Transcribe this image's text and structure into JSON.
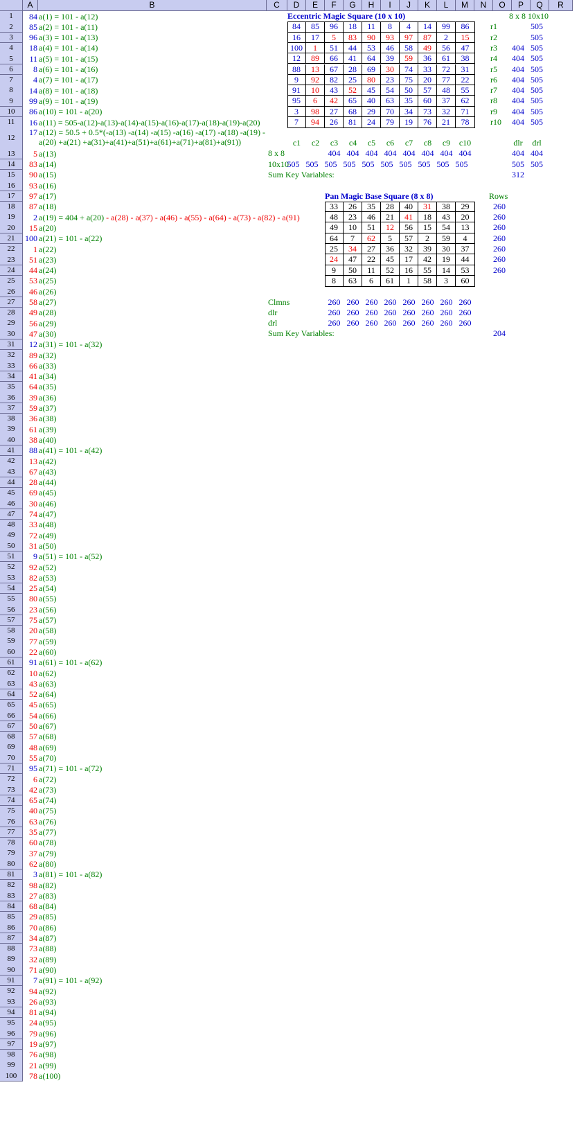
{
  "columns": [
    "A",
    "B",
    "C",
    "D",
    "E",
    "F",
    "G",
    "H",
    "I",
    "J",
    "K",
    "L",
    "M",
    "N",
    "O",
    "P",
    "Q",
    "R"
  ],
  "colors": {
    "blue": "#0000cc",
    "red": "#ee0000",
    "green": "#008000",
    "header_bg": "#c8ccf0"
  },
  "column_a": [
    {
      "v": "84",
      "c": "blue",
      "b": "a(1) = 101 - a(12)"
    },
    {
      "v": "85",
      "c": "blue",
      "b": "a(2) = 101 - a(11)"
    },
    {
      "v": "96",
      "c": "blue",
      "b": "a(3) = 101 - a(13)"
    },
    {
      "v": "18",
      "c": "blue",
      "b": "a(4) = 101 - a(14)"
    },
    {
      "v": "11",
      "c": "blue",
      "b": "a(5) = 101 - a(15)"
    },
    {
      "v": "8",
      "c": "blue",
      "b": "a(6) = 101 - a(16)"
    },
    {
      "v": "4",
      "c": "blue",
      "b": "a(7) = 101 - a(17)"
    },
    {
      "v": "14",
      "c": "blue",
      "b": "a(8) = 101 - a(18)"
    },
    {
      "v": "99",
      "c": "blue",
      "b": "a(9) = 101 - a(19)"
    },
    {
      "v": "86",
      "c": "blue",
      "b": "a(10) = 101 - a(20)"
    },
    {
      "v": "16",
      "c": "blue",
      "b": "a(11) = 505-a(12)-a(13)-a(14)-a(15)-a(16)-a(17)-a(18)-a(19)-a(20)"
    },
    {
      "v": "17",
      "c": "blue",
      "b": "a(12) = 50.5 + 0.5*(-a(13) -a(14) -a(15) -a(16) -a(17) -a(18) -a(19) -",
      "b2": "a(20) +a(21) +a(31)+a(41)+a(51)+a(61)+a(71)+a(81)+a(91))"
    },
    {
      "v": "5",
      "c": "red",
      "b": "a(13)"
    },
    {
      "v": "83",
      "c": "red",
      "b": "a(14)"
    },
    {
      "v": "90",
      "c": "red",
      "b": "a(15)"
    },
    {
      "v": "93",
      "c": "red",
      "b": "a(16)"
    },
    {
      "v": "97",
      "c": "red",
      "b": "a(17)"
    },
    {
      "v": "87",
      "c": "red",
      "b": "a(18)"
    },
    {
      "v": "2",
      "c": "blue",
      "b": "a(19) = 404 + a(20) - a(28) - a(37) - a(46) - a(55) - a(64) - a(73) - a(82) - a(91)",
      "mixed": true
    },
    {
      "v": "15",
      "c": "red",
      "b": "a(20)"
    },
    {
      "v": "100",
      "c": "blue",
      "b": "a(21) = 101 - a(22)"
    },
    {
      "v": "1",
      "c": "red",
      "b": "a(22)"
    },
    {
      "v": "51",
      "c": "red",
      "b": "a(23)"
    },
    {
      "v": "44",
      "c": "red",
      "b": "a(24)"
    },
    {
      "v": "53",
      "c": "red",
      "b": "a(25)"
    },
    {
      "v": "46",
      "c": "red",
      "b": "a(26)"
    },
    {
      "v": "58",
      "c": "red",
      "b": "a(27)"
    },
    {
      "v": "49",
      "c": "red",
      "b": "a(28)"
    },
    {
      "v": "56",
      "c": "red",
      "b": "a(29)"
    },
    {
      "v": "47",
      "c": "red",
      "b": "a(30)"
    },
    {
      "v": "12",
      "c": "blue",
      "b": "a(31) = 101 - a(32)"
    },
    {
      "v": "89",
      "c": "red",
      "b": "a(32)"
    },
    {
      "v": "66",
      "c": "red",
      "b": "a(33)"
    },
    {
      "v": "41",
      "c": "red",
      "b": "a(34)"
    },
    {
      "v": "64",
      "c": "red",
      "b": "a(35)"
    },
    {
      "v": "39",
      "c": "red",
      "b": "a(36)"
    },
    {
      "v": "59",
      "c": "red",
      "b": "a(37)"
    },
    {
      "v": "36",
      "c": "red",
      "b": "a(38)"
    },
    {
      "v": "61",
      "c": "red",
      "b": "a(39)"
    },
    {
      "v": "38",
      "c": "red",
      "b": "a(40)"
    },
    {
      "v": "88",
      "c": "blue",
      "b": "a(41) = 101 - a(42)"
    },
    {
      "v": "13",
      "c": "red",
      "b": "a(42)"
    },
    {
      "v": "67",
      "c": "red",
      "b": "a(43)"
    },
    {
      "v": "28",
      "c": "red",
      "b": "a(44)"
    },
    {
      "v": "69",
      "c": "red",
      "b": "a(45)"
    },
    {
      "v": "30",
      "c": "red",
      "b": "a(46)"
    },
    {
      "v": "74",
      "c": "red",
      "b": "a(47)"
    },
    {
      "v": "33",
      "c": "red",
      "b": "a(48)"
    },
    {
      "v": "72",
      "c": "red",
      "b": "a(49)"
    },
    {
      "v": "31",
      "c": "red",
      "b": "a(50)"
    },
    {
      "v": "9",
      "c": "blue",
      "b": "a(51) = 101 - a(52)"
    },
    {
      "v": "92",
      "c": "red",
      "b": "a(52)"
    },
    {
      "v": "82",
      "c": "red",
      "b": "a(53)"
    },
    {
      "v": "25",
      "c": "red",
      "b": "a(54)"
    },
    {
      "v": "80",
      "c": "red",
      "b": "a(55)"
    },
    {
      "v": "23",
      "c": "red",
      "b": "a(56)"
    },
    {
      "v": "75",
      "c": "red",
      "b": "a(57)"
    },
    {
      "v": "20",
      "c": "red",
      "b": "a(58)"
    },
    {
      "v": "77",
      "c": "red",
      "b": "a(59)"
    },
    {
      "v": "22",
      "c": "red",
      "b": "a(60)"
    },
    {
      "v": "91",
      "c": "blue",
      "b": "a(61) = 101 - a(62)"
    },
    {
      "v": "10",
      "c": "red",
      "b": "a(62)"
    },
    {
      "v": "43",
      "c": "red",
      "b": "a(63)"
    },
    {
      "v": "52",
      "c": "red",
      "b": "a(64)"
    },
    {
      "v": "45",
      "c": "red",
      "b": "a(65)"
    },
    {
      "v": "54",
      "c": "red",
      "b": "a(66)"
    },
    {
      "v": "50",
      "c": "red",
      "b": "a(67)"
    },
    {
      "v": "57",
      "c": "red",
      "b": "a(68)"
    },
    {
      "v": "48",
      "c": "red",
      "b": "a(69)"
    },
    {
      "v": "55",
      "c": "red",
      "b": "a(70)"
    },
    {
      "v": "95",
      "c": "blue",
      "b": "a(71) = 101 - a(72)"
    },
    {
      "v": "6",
      "c": "red",
      "b": "a(72)"
    },
    {
      "v": "42",
      "c": "red",
      "b": "a(73)"
    },
    {
      "v": "65",
      "c": "red",
      "b": "a(74)"
    },
    {
      "v": "40",
      "c": "red",
      "b": "a(75)"
    },
    {
      "v": "63",
      "c": "red",
      "b": "a(76)"
    },
    {
      "v": "35",
      "c": "red",
      "b": "a(77)"
    },
    {
      "v": "60",
      "c": "red",
      "b": "a(78)"
    },
    {
      "v": "37",
      "c": "red",
      "b": "a(79)"
    },
    {
      "v": "62",
      "c": "red",
      "b": "a(80)"
    },
    {
      "v": "3",
      "c": "blue",
      "b": "a(81) = 101 - a(82)"
    },
    {
      "v": "98",
      "c": "red",
      "b": "a(82)"
    },
    {
      "v": "27",
      "c": "red",
      "b": "a(83)"
    },
    {
      "v": "68",
      "c": "red",
      "b": "a(84)"
    },
    {
      "v": "29",
      "c": "red",
      "b": "a(85)"
    },
    {
      "v": "70",
      "c": "red",
      "b": "a(86)"
    },
    {
      "v": "34",
      "c": "red",
      "b": "a(87)"
    },
    {
      "v": "73",
      "c": "red",
      "b": "a(88)"
    },
    {
      "v": "32",
      "c": "red",
      "b": "a(89)"
    },
    {
      "v": "71",
      "c": "red",
      "b": "a(90)"
    },
    {
      "v": "7",
      "c": "blue",
      "b": "a(91) = 101 - a(92)"
    },
    {
      "v": "94",
      "c": "red",
      "b": "a(92)"
    },
    {
      "v": "26",
      "c": "red",
      "b": "a(93)"
    },
    {
      "v": "81",
      "c": "red",
      "b": "a(94)"
    },
    {
      "v": "24",
      "c": "red",
      "b": "a(95)"
    },
    {
      "v": "79",
      "c": "red",
      "b": "a(96)"
    },
    {
      "v": "19",
      "c": "red",
      "b": "a(97)"
    },
    {
      "v": "76",
      "c": "red",
      "b": "a(98)"
    },
    {
      "v": "21",
      "c": "red",
      "b": "a(99)"
    },
    {
      "v": "78",
      "c": "red",
      "b": "a(100)"
    }
  ],
  "row19_parts": [
    {
      "t": "a(19) = 404 + a(20) ",
      "c": "green"
    },
    {
      "t": "- a(28) - a(37) - a(46) - a(55) - a(64) - a(73) - a(82) - a(91)",
      "c": "red"
    }
  ],
  "eccentric": {
    "title": "Eccentric Magic Square (10 x 10)",
    "rows": [
      [
        [
          "84",
          "b"
        ],
        [
          "85",
          "b"
        ],
        [
          "96",
          "b"
        ],
        [
          "18",
          "b"
        ],
        [
          "11",
          "b"
        ],
        [
          "8",
          "b"
        ],
        [
          "4",
          "b"
        ],
        [
          "14",
          "b"
        ],
        [
          "99",
          "b"
        ],
        [
          "86",
          "b"
        ]
      ],
      [
        [
          "16",
          "b"
        ],
        [
          "17",
          "b"
        ],
        [
          "5",
          "r"
        ],
        [
          "83",
          "r"
        ],
        [
          "90",
          "r"
        ],
        [
          "93",
          "r"
        ],
        [
          "97",
          "r"
        ],
        [
          "87",
          "r"
        ],
        [
          "2",
          "b"
        ],
        [
          "15",
          "r"
        ]
      ],
      [
        [
          "100",
          "b"
        ],
        [
          "1",
          "r"
        ],
        [
          "51",
          "b"
        ],
        [
          "44",
          "b"
        ],
        [
          "53",
          "b"
        ],
        [
          "46",
          "b"
        ],
        [
          "58",
          "b"
        ],
        [
          "49",
          "r"
        ],
        [
          "56",
          "b"
        ],
        [
          "47",
          "b"
        ]
      ],
      [
        [
          "12",
          "b"
        ],
        [
          "89",
          "r"
        ],
        [
          "66",
          "b"
        ],
        [
          "41",
          "b"
        ],
        [
          "64",
          "b"
        ],
        [
          "39",
          "b"
        ],
        [
          "59",
          "r"
        ],
        [
          "36",
          "b"
        ],
        [
          "61",
          "b"
        ],
        [
          "38",
          "b"
        ]
      ],
      [
        [
          "88",
          "b"
        ],
        [
          "13",
          "r"
        ],
        [
          "67",
          "b"
        ],
        [
          "28",
          "b"
        ],
        [
          "69",
          "b"
        ],
        [
          "30",
          "r"
        ],
        [
          "74",
          "b"
        ],
        [
          "33",
          "b"
        ],
        [
          "72",
          "b"
        ],
        [
          "31",
          "b"
        ]
      ],
      [
        [
          "9",
          "b"
        ],
        [
          "92",
          "r"
        ],
        [
          "82",
          "b"
        ],
        [
          "25",
          "b"
        ],
        [
          "80",
          "r"
        ],
        [
          "23",
          "b"
        ],
        [
          "75",
          "b"
        ],
        [
          "20",
          "b"
        ],
        [
          "77",
          "b"
        ],
        [
          "22",
          "b"
        ]
      ],
      [
        [
          "91",
          "b"
        ],
        [
          "10",
          "r"
        ],
        [
          "43",
          "b"
        ],
        [
          "52",
          "r"
        ],
        [
          "45",
          "b"
        ],
        [
          "54",
          "b"
        ],
        [
          "50",
          "b"
        ],
        [
          "57",
          "b"
        ],
        [
          "48",
          "b"
        ],
        [
          "55",
          "b"
        ]
      ],
      [
        [
          "95",
          "b"
        ],
        [
          "6",
          "r"
        ],
        [
          "42",
          "r"
        ],
        [
          "65",
          "b"
        ],
        [
          "40",
          "b"
        ],
        [
          "63",
          "b"
        ],
        [
          "35",
          "b"
        ],
        [
          "60",
          "b"
        ],
        [
          "37",
          "b"
        ],
        [
          "62",
          "b"
        ]
      ],
      [
        [
          "3",
          "b"
        ],
        [
          "98",
          "r"
        ],
        [
          "27",
          "b"
        ],
        [
          "68",
          "b"
        ],
        [
          "29",
          "b"
        ],
        [
          "70",
          "b"
        ],
        [
          "34",
          "b"
        ],
        [
          "73",
          "b"
        ],
        [
          "32",
          "b"
        ],
        [
          "71",
          "b"
        ]
      ],
      [
        [
          "7",
          "b"
        ],
        [
          "94",
          "r"
        ],
        [
          "26",
          "b"
        ],
        [
          "81",
          "b"
        ],
        [
          "24",
          "b"
        ],
        [
          "79",
          "b"
        ],
        [
          "19",
          "b"
        ],
        [
          "76",
          "b"
        ],
        [
          "21",
          "b"
        ],
        [
          "78",
          "b"
        ]
      ]
    ],
    "row_labels": [
      "r1",
      "r2",
      "r3",
      "r4",
      "r5",
      "r6",
      "r7",
      "r8",
      "r9",
      "r10"
    ],
    "col8_header": "8 x 8",
    "col10_header": "10x10",
    "col8": [
      "",
      "",
      "404",
      "404",
      "404",
      "404",
      "404",
      "404",
      "404",
      "404"
    ],
    "col10": [
      "505",
      "505",
      "505",
      "505",
      "505",
      "505",
      "505",
      "505",
      "505",
      "505"
    ],
    "col_labels": [
      "c1",
      "c2",
      "c3",
      "c4",
      "c5",
      "c6",
      "c7",
      "c8",
      "c9",
      "c10"
    ],
    "diag_labels": [
      "dlr",
      "drl"
    ],
    "row13_label": "8 x 8",
    "row13_values": [
      "",
      "",
      "404",
      "404",
      "404",
      "404",
      "404",
      "404",
      "404",
      "404"
    ],
    "row13_diag": [
      "404",
      "404"
    ],
    "row14_label": "10x10",
    "row14_values": [
      "505",
      "505",
      "505",
      "505",
      "505",
      "505",
      "505",
      "505",
      "505",
      "505"
    ],
    "row14_diag": [
      "505",
      "505"
    ],
    "sum_label": "Sum Key Variables:",
    "sum_value": "312"
  },
  "panmagic": {
    "title": "Pan Magic Base Square (8 x 8)",
    "rows": [
      [
        [
          "33",
          "k"
        ],
        [
          "26",
          "k"
        ],
        [
          "35",
          "k"
        ],
        [
          "28",
          "k"
        ],
        [
          "40",
          "k"
        ],
        [
          "31",
          "r"
        ],
        [
          "38",
          "k"
        ],
        [
          "29",
          "k"
        ]
      ],
      [
        [
          "48",
          "k"
        ],
        [
          "23",
          "k"
        ],
        [
          "46",
          "k"
        ],
        [
          "21",
          "k"
        ],
        [
          "41",
          "r"
        ],
        [
          "18",
          "k"
        ],
        [
          "43",
          "k"
        ],
        [
          "20",
          "k"
        ]
      ],
      [
        [
          "49",
          "k"
        ],
        [
          "10",
          "k"
        ],
        [
          "51",
          "k"
        ],
        [
          "12",
          "r"
        ],
        [
          "56",
          "k"
        ],
        [
          "15",
          "k"
        ],
        [
          "54",
          "k"
        ],
        [
          "13",
          "k"
        ]
      ],
      [
        [
          "64",
          "k"
        ],
        [
          "7",
          "k"
        ],
        [
          "62",
          "r"
        ],
        [
          "5",
          "k"
        ],
        [
          "57",
          "k"
        ],
        [
          "2",
          "k"
        ],
        [
          "59",
          "k"
        ],
        [
          "4",
          "k"
        ]
      ],
      [
        [
          "25",
          "k"
        ],
        [
          "34",
          "r"
        ],
        [
          "27",
          "k"
        ],
        [
          "36",
          "k"
        ],
        [
          "32",
          "k"
        ],
        [
          "39",
          "k"
        ],
        [
          "30",
          "k"
        ],
        [
          "37",
          "k"
        ]
      ],
      [
        [
          "24",
          "r"
        ],
        [
          "47",
          "k"
        ],
        [
          "22",
          "k"
        ],
        [
          "45",
          "k"
        ],
        [
          "17",
          "k"
        ],
        [
          "42",
          "k"
        ],
        [
          "19",
          "k"
        ],
        [
          "44",
          "k"
        ]
      ],
      [
        [
          "9",
          "k"
        ],
        [
          "50",
          "k"
        ],
        [
          "11",
          "k"
        ],
        [
          "52",
          "k"
        ],
        [
          "16",
          "k"
        ],
        [
          "55",
          "k"
        ],
        [
          "14",
          "k"
        ],
        [
          "53",
          "k"
        ]
      ],
      [
        [
          "8",
          "k"
        ],
        [
          "63",
          "k"
        ],
        [
          "6",
          "k"
        ],
        [
          "61",
          "k"
        ],
        [
          "1",
          "k"
        ],
        [
          "58",
          "k"
        ],
        [
          "3",
          "k"
        ],
        [
          "60",
          "k"
        ]
      ]
    ],
    "rows_header": "Rows",
    "rows_sums": [
      "260",
      "260",
      "260",
      "260",
      "260",
      "260",
      "260"
    ],
    "clmns_label": "Clmns",
    "dlr_label": "dlr",
    "drl_label": "drl",
    "clmns": [
      "260",
      "260",
      "260",
      "260",
      "260",
      "260",
      "260",
      "260"
    ],
    "dlr": [
      "260",
      "260",
      "260",
      "260",
      "260",
      "260",
      "260",
      "260"
    ],
    "drl": [
      "260",
      "260",
      "260",
      "260",
      "260",
      "260",
      "260",
      "260"
    ],
    "sum_label": "Sum Key Variables:",
    "sum_value": "204"
  }
}
